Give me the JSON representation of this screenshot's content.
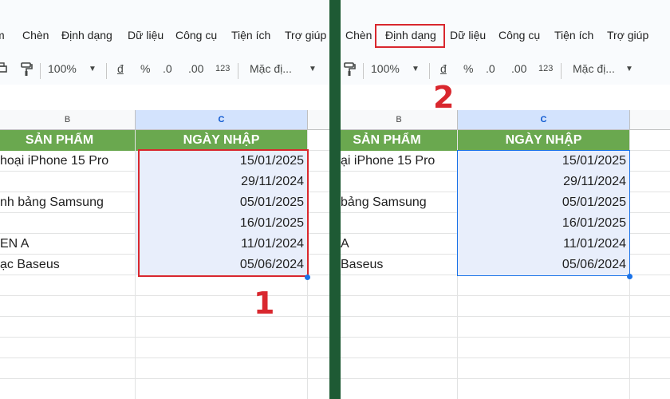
{
  "left_panel": {
    "menu": [
      "m",
      "Chèn",
      "Định dạng",
      "Dữ liệu",
      "Công cụ",
      "Tiện ích",
      "Trợ giúp"
    ],
    "toolbar": {
      "zoom": "100%",
      "currency": "đ",
      "percent": "%",
      "decrease_decimal": ".0",
      "increase_decimal": ".00",
      "number_format": "123",
      "font": "Mặc đị..."
    },
    "columns": [
      "B",
      "C"
    ],
    "header_row": [
      "SẢN PHẨM",
      "NGÀY NHẬP"
    ],
    "rows": [
      [
        "hoại iPhone 15 Pro",
        "15/01/2025"
      ],
      [
        "",
        "29/11/2024"
      ],
      [
        "nh bảng Samsung",
        "05/01/2025"
      ],
      [
        "",
        "16/01/2025"
      ],
      [
        "EN A",
        "11/01/2024"
      ],
      [
        "ạc Baseus",
        "05/06/2024"
      ]
    ],
    "step_label": "1"
  },
  "right_panel": {
    "menu": [
      "Chèn",
      "Định dạng",
      "Dữ liệu",
      "Công cụ",
      "Tiện ích",
      "Trợ giúp"
    ],
    "toolbar": {
      "zoom": "100%",
      "currency": "đ",
      "percent": "%",
      "decrease_decimal": ".0",
      "increase_decimal": ".00",
      "number_format": "123",
      "font": "Mặc đị..."
    },
    "columns": [
      "B",
      "C"
    ],
    "header_row": [
      "SẢN PHẨM",
      "NGÀY NHẬP"
    ],
    "rows": [
      [
        "ại iPhone 15 Pro",
        "15/01/2025"
      ],
      [
        "",
        "29/11/2024"
      ],
      [
        "bảng Samsung",
        "05/01/2025"
      ],
      [
        "",
        "16/01/2025"
      ],
      [
        "A",
        "11/01/2024"
      ],
      [
        "Baseus",
        "05/06/2024"
      ]
    ],
    "step_label": "2"
  },
  "colors": {
    "header_green": "#6aa84f",
    "highlight_red": "#d9272e",
    "selection_blue": "#1a73e8",
    "divider_green": "#1e5a34"
  }
}
